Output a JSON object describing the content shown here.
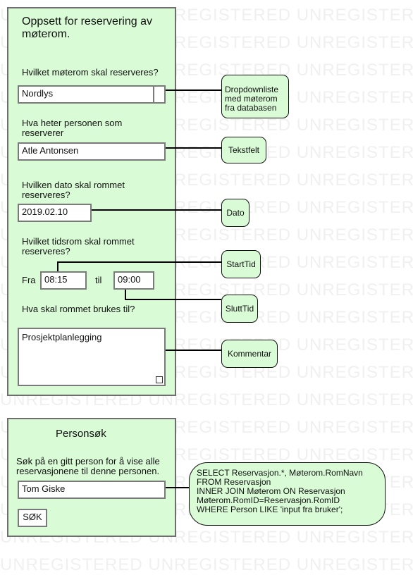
{
  "watermark": "UNREGISTERED UNREGISTERED UNREGISTERED",
  "setup_panel": {
    "title": "Oppsett for reservering av møterom.",
    "room_label": "Hvilket møterom skal reserveres?",
    "room_value": "Nordlys",
    "person_label": "Hva heter personen som reserverer",
    "person_value": "Atle Antonsen",
    "date_label": "Hvilken dato skal rommet reserveres?",
    "date_value": "2019.02.10",
    "time_label": "Hvilket tidsrom skal rommet reserveres?",
    "from_label": "Fra",
    "from_value": "08:15",
    "to_label": "til",
    "to_value": "09:00",
    "purpose_label": "Hva skal rommet brukes til?",
    "purpose_value": "Prosjektplanlegging"
  },
  "notes": {
    "dropdown": "Dropdownliste med møterom fra databasen",
    "textfield": "Tekstfelt",
    "date": "Dato",
    "start": "StartTid",
    "end": "SluttTid",
    "comment": "Kommentar"
  },
  "search_panel": {
    "title": "Personsøk",
    "description": "Søk på en gitt person for å vise alle reservasjonene til denne personen.",
    "input_value": "Tom Giske",
    "button_label": "SØK"
  },
  "sql_note": {
    "lines": [
      "SELECT Reservasjon.*, Møterom.RomNavn",
      "FROM Reservasjon",
      "INNER JOIN Møterom ON Reservasjon",
      "Møterom.RomID=Reservasjon.RomID",
      "WHERE Person LIKE 'input fra bruker';"
    ]
  }
}
